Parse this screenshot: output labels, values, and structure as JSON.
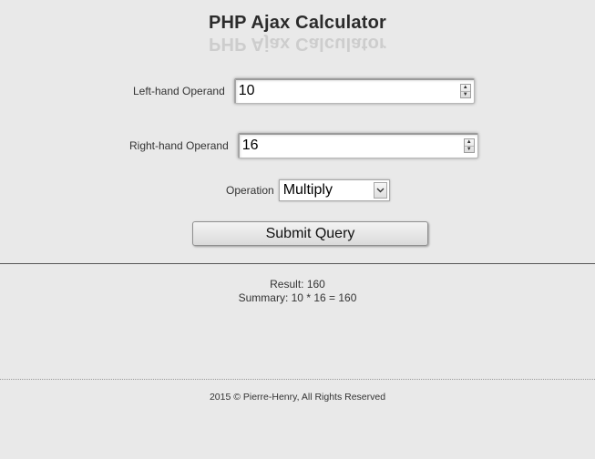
{
  "page": {
    "title": "PHP Ajax Calculator"
  },
  "form": {
    "left_label": "Left-hand Operand",
    "left_value": "10",
    "right_label": "Right-hand Operand",
    "right_value": "16",
    "operation_label": "Operation",
    "operation_selected": "Multiply",
    "submit_label": "Submit Query"
  },
  "result": {
    "result_line": "Result: 160",
    "summary_line": "Summary: 10 * 16 = 160"
  },
  "footer": {
    "text": "2015 © Pierre-Henry, All Rights Reserved"
  },
  "icons": {
    "spinner_up": "arrow-up-icon",
    "spinner_down": "arrow-down-icon",
    "select_arrow": "chevron-down-icon"
  },
  "colors": {
    "background": "#e9e9e9",
    "title": "#2b2b2b",
    "title_reflection": "#c9c9c9"
  }
}
